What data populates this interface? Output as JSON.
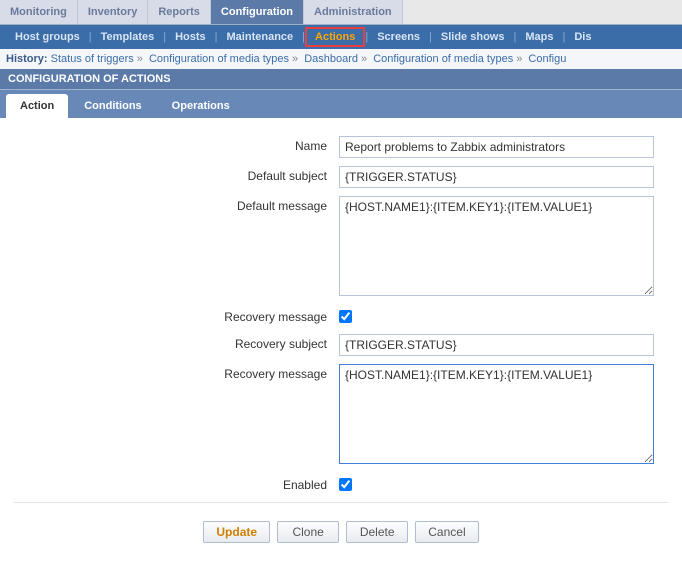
{
  "top_tabs": {
    "items": [
      "Monitoring",
      "Inventory",
      "Reports",
      "Configuration",
      "Administration"
    ],
    "active": 3
  },
  "sub_nav": {
    "items": [
      "Host groups",
      "Templates",
      "Hosts",
      "Maintenance",
      "Actions",
      "Screens",
      "Slide shows",
      "Maps",
      "Dis"
    ],
    "highlight": 4
  },
  "breadcrumb": {
    "label": "History:",
    "items": [
      "Status of triggers",
      "Configuration of media types",
      "Dashboard",
      "Configuration of media types",
      "Configu"
    ]
  },
  "page_header": "CONFIGURATION OF ACTIONS",
  "cfg_tabs": {
    "items": [
      "Action",
      "Conditions",
      "Operations"
    ],
    "active": 0
  },
  "form": {
    "name": {
      "label": "Name",
      "value": "Report problems to Zabbix administrators"
    },
    "default_subject": {
      "label": "Default subject",
      "value": "{TRIGGER.STATUS}"
    },
    "default_message": {
      "label": "Default message",
      "value": "{HOST.NAME1}:{ITEM.KEY1}:{ITEM.VALUE1}"
    },
    "recovery_checkbox": {
      "label": "Recovery message",
      "checked": true
    },
    "recovery_subject": {
      "label": "Recovery subject",
      "value": "{TRIGGER.STATUS}"
    },
    "recovery_message": {
      "label": "Recovery message",
      "value": "{HOST.NAME1}:{ITEM.KEY1}:{ITEM.VALUE1}"
    },
    "enabled": {
      "label": "Enabled",
      "checked": true
    }
  },
  "buttons": {
    "update": "Update",
    "clone": "Clone",
    "delete": "Delete",
    "cancel": "Cancel"
  }
}
